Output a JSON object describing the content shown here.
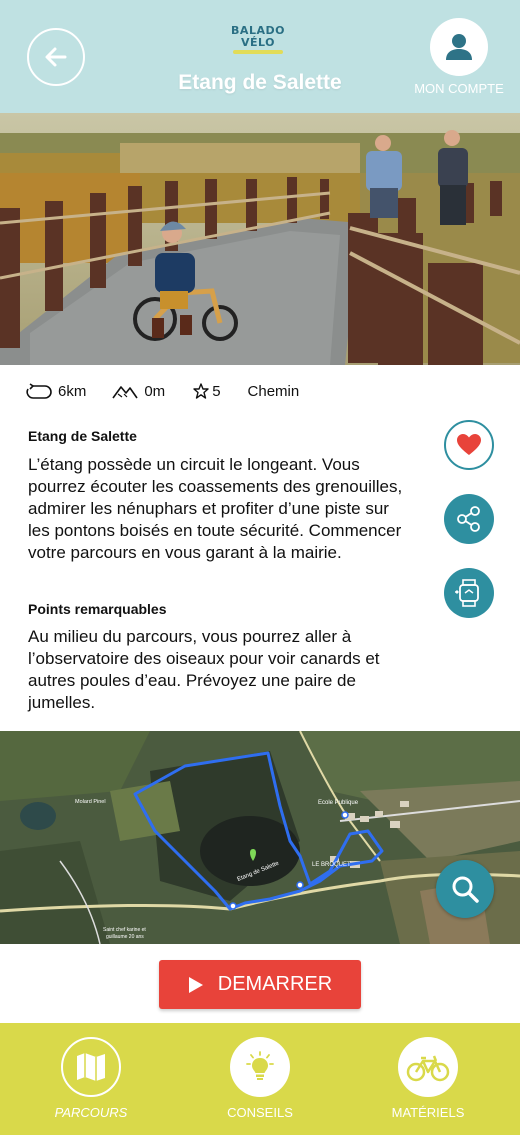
{
  "header": {
    "logo_line1": "BALADO",
    "logo_line2": "VÉLO",
    "title": "Etang de Salette",
    "account_label": "MON COMPTE",
    "icons": {
      "back": "arrow-left-icon",
      "account": "user-icon"
    }
  },
  "stats": {
    "distance": "6km",
    "elevation": "0m",
    "rating": "5",
    "surface": "Chemin"
  },
  "description": {
    "title": "Etang de Salette",
    "text": "L’étang possède un circuit le longeant. Vous pourrez écouter les coassements des grenouilles, admirer les nénuphars et profiter d’une piste sur les pontons boisés en toute sécurité. Commencer votre parcours en vous garant à la mairie."
  },
  "points": {
    "title": "Points remarquables",
    "text": "Au milieu du parcours, vous pourrez aller à l’observatoire des oiseaux pour voir canards et autres poules d’eau. Prévoyez une paire de jumelles."
  },
  "side_actions": {
    "favorite": "heart-icon",
    "share": "share-icon",
    "watch": "smartwatch-icon"
  },
  "map": {
    "labels": {
      "ecole": "Ecole Publique",
      "etang": "Etang de Salette",
      "broquet": "LE BROQUET",
      "molard": "Molard Pinel",
      "saint": "Saint chef karine et",
      "saint2": "guillaume 20 ans"
    }
  },
  "start_button": {
    "label": "DEMARRER"
  },
  "bottom_nav": {
    "items": [
      {
        "label": "PARCOURS",
        "icon": "map-icon",
        "active": true
      },
      {
        "label": "CONSEILS",
        "icon": "lightbulb-icon",
        "active": false
      },
      {
        "label": "MATÉRIELS",
        "icon": "bicycle-icon",
        "active": false
      }
    ]
  },
  "colors": {
    "header_bg": "#bfe1e2",
    "accent": "#2e8fa0",
    "nav_bg": "#d9d94a",
    "start": "#e8433a",
    "heart": "#e8433a"
  }
}
